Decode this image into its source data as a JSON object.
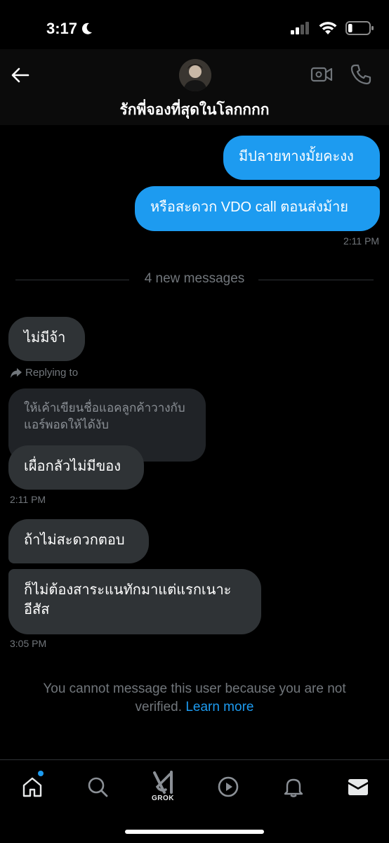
{
  "status_bar": {
    "time": "3:17",
    "moon_icon": "moon-icon",
    "signal_icon": "cellular-signal-icon",
    "wifi_icon": "wifi-icon",
    "battery_icon": "battery-icon",
    "battery_level": 0.2
  },
  "header": {
    "back_icon": "arrow-left-icon",
    "title": "รักพี่จองที่สุดในโลกกกก",
    "video_icon": "video-camera-icon",
    "call_icon": "phone-icon"
  },
  "messages": {
    "sent": [
      "มีปลายทางมั้ยคะงง",
      "หรือสะดวก VDO call ตอนส่งม้าย"
    ],
    "sent_time": "2:11 PM",
    "new_messages_divider": "4 new messages",
    "recv1": "ไม่มีจ้า",
    "reply_label": "Replying to",
    "quoted_text": "ให้เค้าเขียนชื่อแอคลูกค้าวางกับแอร์พอดให้ได้งับ",
    "recv2": "เผื่อกลัวไม่มีของ",
    "recv2_time": "2:11 PM",
    "recv3": "ถ้าไม่สะดวกตอบ",
    "recv4": "ก็ไม่ต้องสาระแนทักมาแต่แรกเนาะอีสัส",
    "recv4_time": "3:05 PM"
  },
  "notice": {
    "text": "You cannot message this user because you are not verified.",
    "link": "Learn more"
  },
  "nav": {
    "home_icon": "home-icon",
    "search_icon": "search-icon",
    "grok_icon": "grok-icon",
    "grok_label": "GROK",
    "video_icon": "play-circle-icon",
    "notifications_icon": "bell-icon",
    "messages_icon": "envelope-icon"
  },
  "colors": {
    "accent": "#1d9bf0",
    "received_bubble": "#2f3336",
    "background": "#000000"
  }
}
